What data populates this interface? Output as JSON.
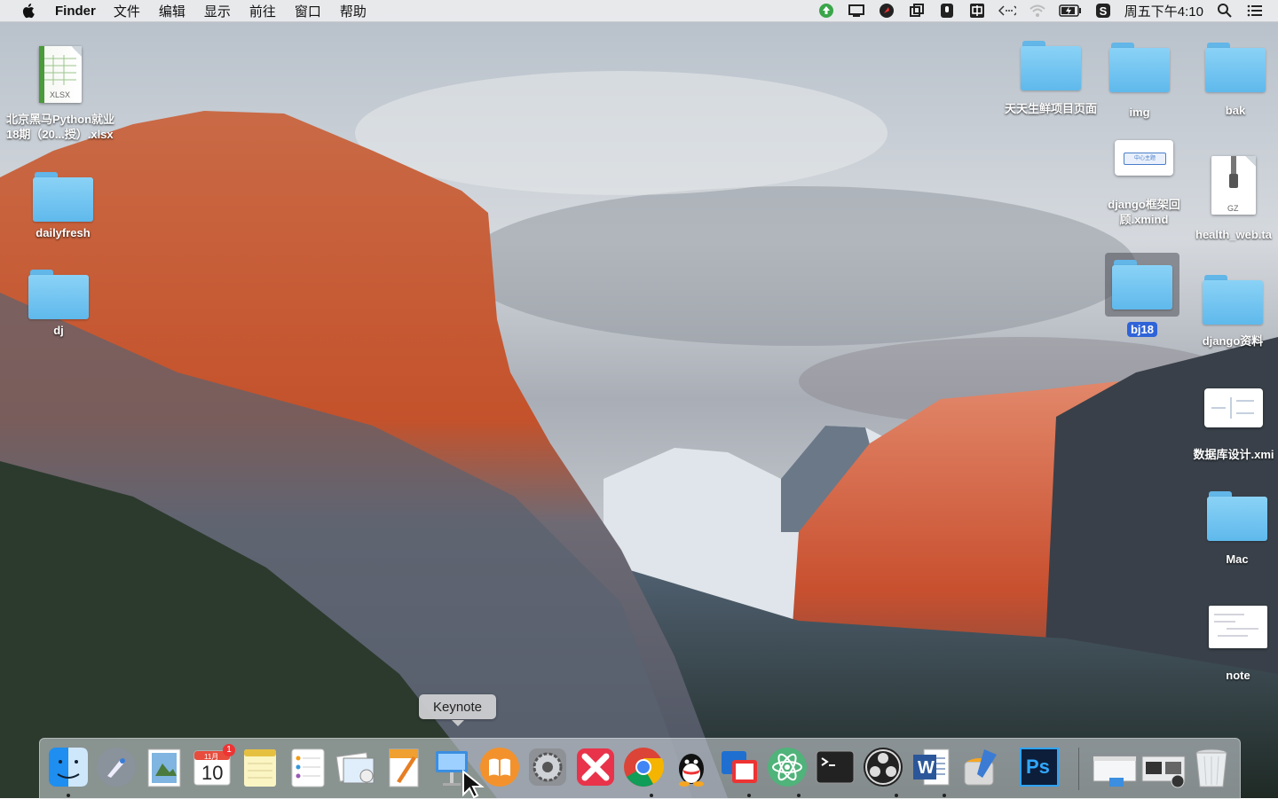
{
  "menubar": {
    "app_name": "Finder",
    "menus": [
      "文件",
      "编辑",
      "显示",
      "前往",
      "窗口",
      "帮助"
    ],
    "clock": "周五下午4:10",
    "status_icons": [
      "upload-arrow-icon",
      "monitor-icon",
      "rocket-icon",
      "screen-capture-icon",
      "microphone-icon",
      "input-method-icon",
      "code-brackets-icon",
      "wifi-icon",
      "battery-icon",
      "sogou-icon",
      "search-icon",
      "list-icon"
    ]
  },
  "desktop": {
    "left_items": [
      {
        "label_line1": "北京黑马Python就业",
        "label_line2": "18期（20...授）.xlsx",
        "type": "xlsx",
        "file_tag": "XLSX"
      },
      {
        "label": "dailyfresh",
        "type": "folder"
      },
      {
        "label": "dj",
        "type": "folder"
      }
    ],
    "right_items": [
      {
        "label": "天天生鲜项目页面",
        "type": "folder"
      },
      {
        "label": "img",
        "type": "folder"
      },
      {
        "label": "bak",
        "type": "folder"
      },
      {
        "label_line1": "django框架回",
        "label_line2": "顾.xmind",
        "type": "xmind",
        "thumb_text": "中心主题"
      },
      {
        "label": "health_web.ta",
        "type": "gz",
        "file_tag": "GZ"
      },
      {
        "label": "bj18",
        "type": "folder",
        "selected": true
      },
      {
        "label": "django资料",
        "type": "folder"
      },
      {
        "label": "数据库设计.xmi",
        "type": "xmind"
      },
      {
        "label": "Mac",
        "type": "folder"
      },
      {
        "label": "note",
        "type": "document"
      }
    ]
  },
  "dock": {
    "tooltip": "Keynote",
    "apps": [
      "Finder",
      "Launchpad",
      "Preview",
      "Calendar",
      "Notes",
      "Reminders",
      "Photos Gallery",
      "Pages",
      "Keynote",
      "iBooks",
      "System Preferences",
      "XMind",
      "Google Chrome",
      "QQ",
      "TeamViewer",
      "Atom",
      "Terminal",
      "OBS",
      "Microsoft Word",
      "Sublime Text",
      "Photoshop"
    ],
    "calendar": {
      "month": "11月",
      "day": "10",
      "badge": "1"
    },
    "word_letter": "W",
    "ps_letters": "Ps",
    "trash": "Trash"
  },
  "colors": {
    "folder": "#7cc8f2",
    "selection": "#2f63d8",
    "menubar": "#ececee"
  }
}
